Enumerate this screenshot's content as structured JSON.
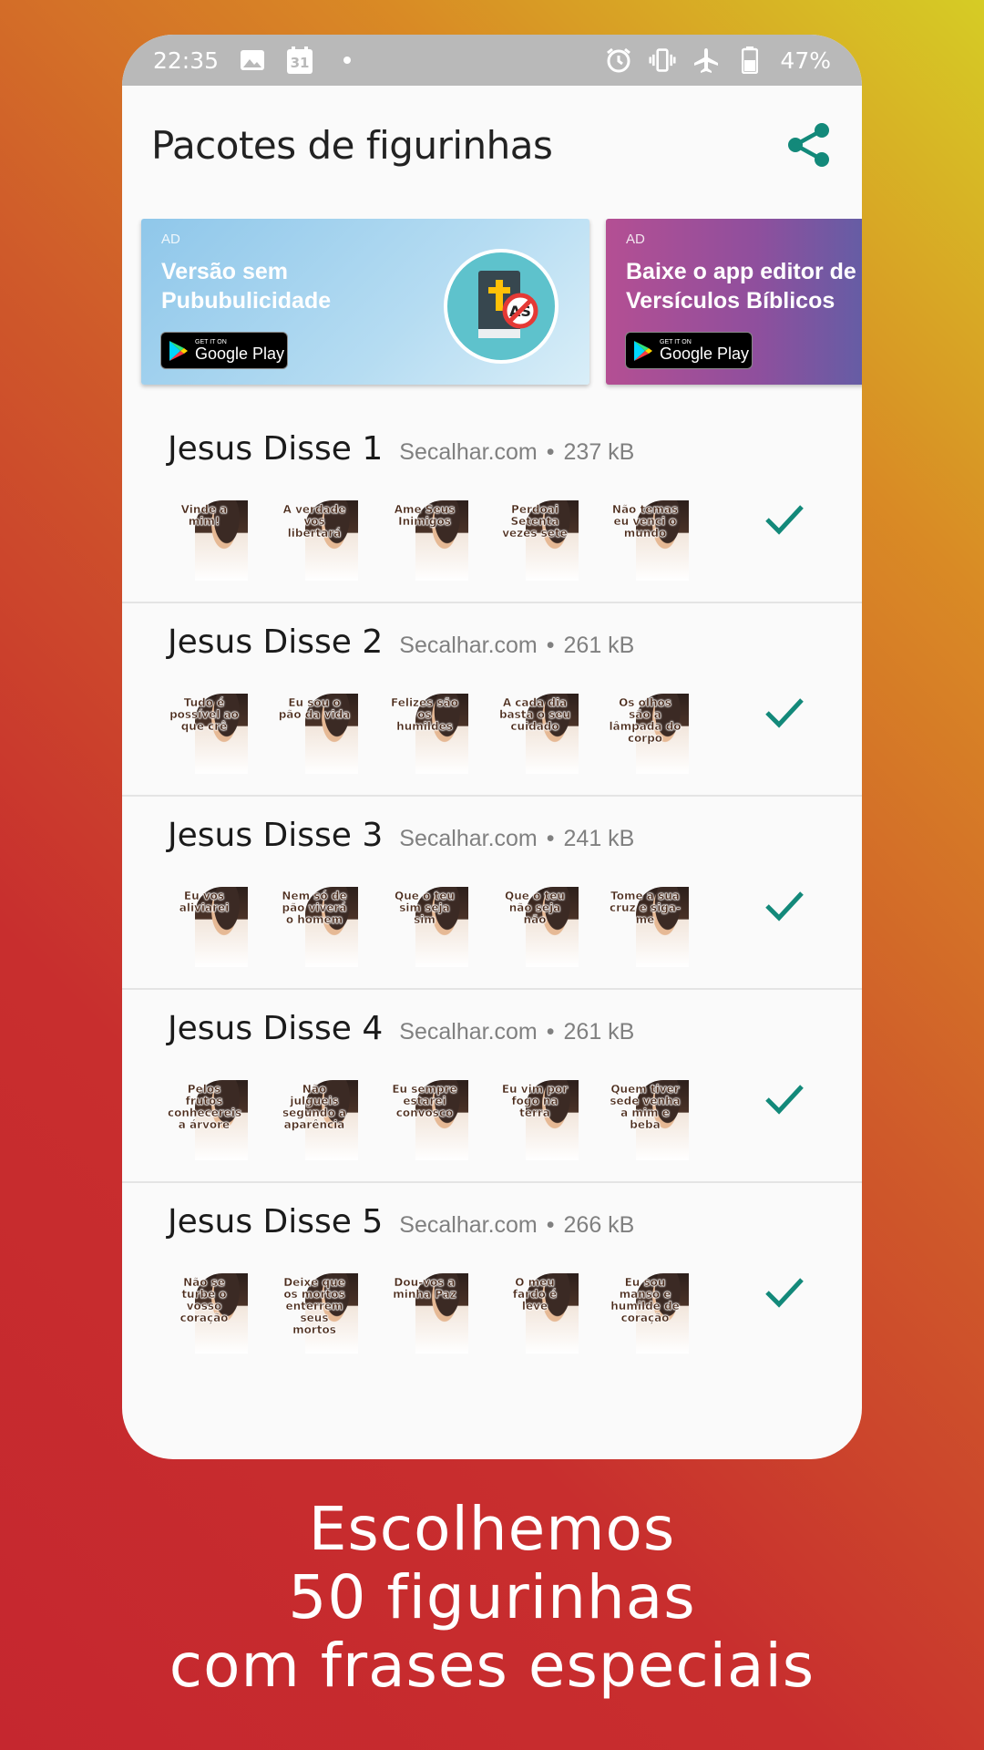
{
  "statusbar": {
    "time": "22:35",
    "calendar_day": "31",
    "battery": "47%",
    "icons": [
      "image-icon",
      "calendar-icon",
      "dot-icon",
      "alarm-icon",
      "vibrate-icon",
      "airplane-icon",
      "battery-icon"
    ]
  },
  "appbar": {
    "title": "Pacotes de figurinhas",
    "share_icon": "share-icon",
    "accent_color": "#13897a"
  },
  "ads": [
    {
      "tag": "AD",
      "title": "Versão sem\n Pububulicidade",
      "store_small": "GET IT ON",
      "store_big": "Google Play"
    },
    {
      "tag": "AD",
      "title": "Baixe o app editor de\nVersículos Bíblicos",
      "store_small": "GET IT ON",
      "store_big": "Google Play"
    }
  ],
  "packs": [
    {
      "name": "Jesus Disse 1",
      "publisher": "Secalhar.com",
      "size": "237 kB",
      "stickers": [
        "Vinde a mim!",
        "A verdade vos libertará",
        "Ame Seus Inimigos",
        "Perdoai Setenta vezes sete",
        "Não temas eu venci o mundo"
      ]
    },
    {
      "name": "Jesus Disse 2",
      "publisher": "Secalhar.com",
      "size": "261 kB",
      "stickers": [
        "Tudo é possível ao que crê",
        "Eu sou o pão da vida",
        "Felizes são os humildes",
        "A cada dia basta o seu cuidado",
        "Os olhos são a lâmpada do corpo"
      ]
    },
    {
      "name": "Jesus Disse 3",
      "publisher": "Secalhar.com",
      "size": "241 kB",
      "stickers": [
        "Eu vos aliviarei",
        "Nem só de pão viverá o homem",
        "Que o teu sim seja sim",
        "Que o teu não seja não",
        "Tome a sua cruz e siga-me"
      ]
    },
    {
      "name": "Jesus Disse 4",
      "publisher": "Secalhar.com",
      "size": "261 kB",
      "stickers": [
        "Pelos frutos conhecereis a árvore",
        "Não julgueis segundo a aparência",
        "Eu sempre estarei convosco",
        "Eu vim por fogo na terra",
        "Quem tiver sede venha a mim e beba"
      ]
    },
    {
      "name": "Jesus Disse 5",
      "publisher": "Secalhar.com",
      "size": "266 kB",
      "stickers": [
        "Não se turbe o vosso coração",
        "Deixe que os mortos enterrem seus mortos",
        "Dou-vos a minha Paz",
        "O meu fardo é leve",
        "Eu sou manso e humilde de coração"
      ]
    }
  ],
  "caption": {
    "line1": "Escolhemos",
    "line2": "50 figurinhas",
    "line3": "com frases especiais"
  }
}
